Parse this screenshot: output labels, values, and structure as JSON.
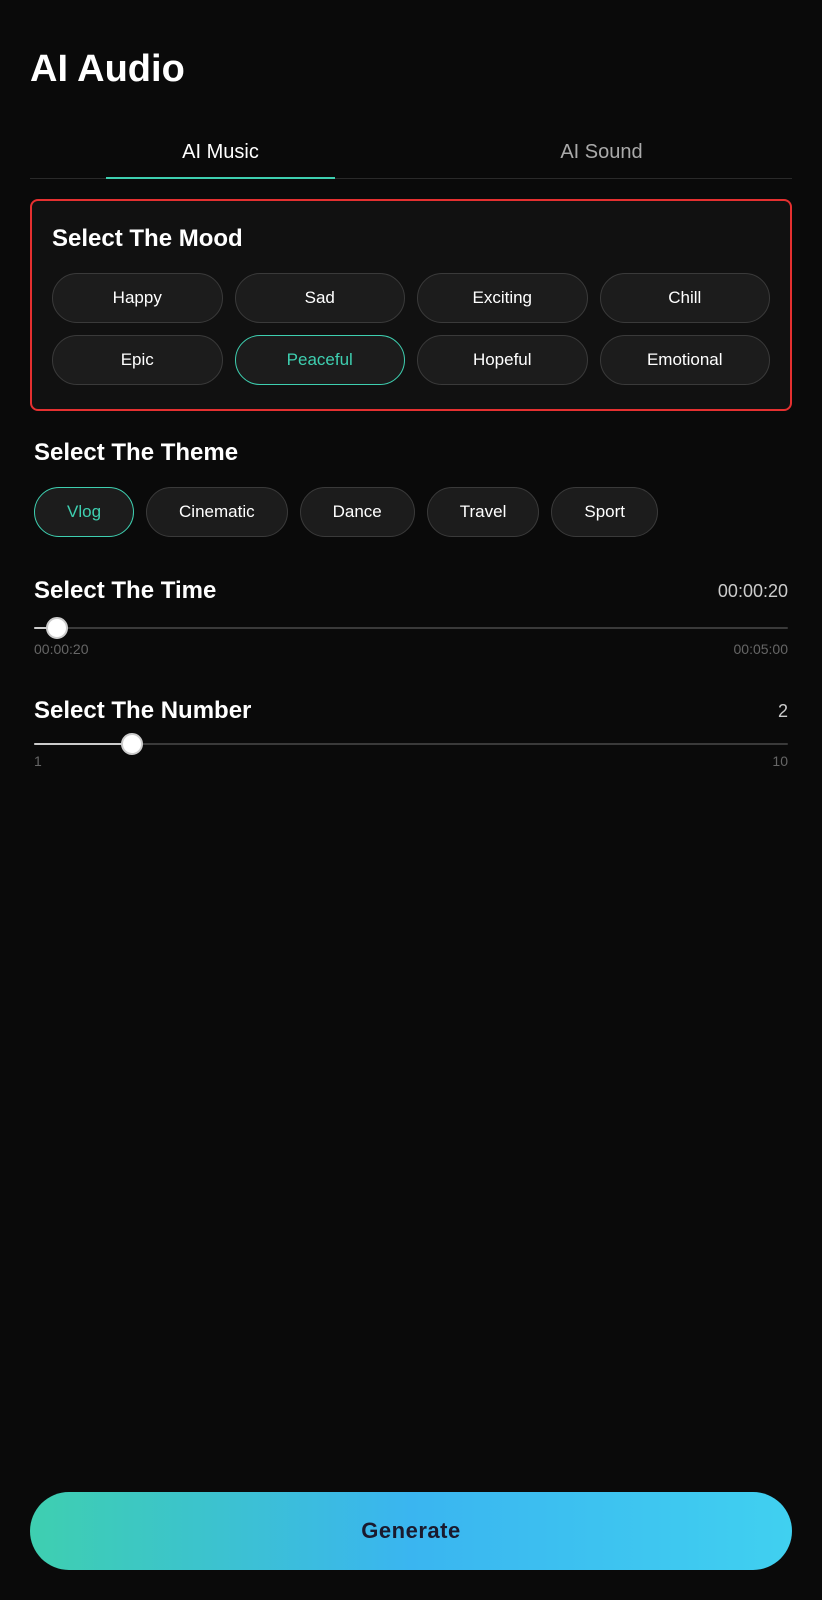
{
  "page": {
    "title": "AI Audio"
  },
  "tabs": [
    {
      "id": "ai-music",
      "label": "AI Music",
      "active": true
    },
    {
      "id": "ai-sound",
      "label": "AI Sound",
      "active": false
    }
  ],
  "mood": {
    "section_title": "Select The Mood",
    "buttons": [
      {
        "id": "happy",
        "label": "Happy",
        "selected": false
      },
      {
        "id": "sad",
        "label": "Sad",
        "selected": false
      },
      {
        "id": "exciting",
        "label": "Exciting",
        "selected": false
      },
      {
        "id": "chill",
        "label": "Chill",
        "selected": false
      },
      {
        "id": "epic",
        "label": "Epic",
        "selected": false
      },
      {
        "id": "peaceful",
        "label": "Peaceful",
        "selected": true
      },
      {
        "id": "hopeful",
        "label": "Hopeful",
        "selected": false
      },
      {
        "id": "emotional",
        "label": "Emotional",
        "selected": false
      }
    ]
  },
  "theme": {
    "section_title": "Select The Theme",
    "buttons": [
      {
        "id": "vlog",
        "label": "Vlog",
        "selected": true
      },
      {
        "id": "cinematic",
        "label": "Cinematic",
        "selected": false
      },
      {
        "id": "dance",
        "label": "Dance",
        "selected": false
      },
      {
        "id": "travel",
        "label": "Travel",
        "selected": false
      },
      {
        "id": "sport",
        "label": "Sport",
        "selected": false
      }
    ]
  },
  "time": {
    "section_title": "Select The Time",
    "current_value": "00:00:20",
    "min_label": "00:00:20",
    "max_label": "00:05:00",
    "slider_percent": 4
  },
  "number": {
    "section_title": "Select The Number",
    "current_value": "2",
    "min_label": "1",
    "max_label": "10",
    "slider_percent": 14
  },
  "generate_button": {
    "label": "Generate"
  }
}
